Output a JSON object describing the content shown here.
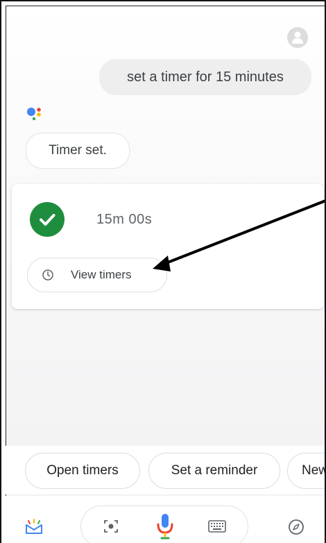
{
  "conversation": {
    "user_query": "set a timer for 15 minutes",
    "assistant_reply": "Timer set."
  },
  "timer_card": {
    "status_icon": "check-circle-icon",
    "remaining": "15m 00s",
    "view_button_label": "View timers",
    "view_button_icon": "clock-icon"
  },
  "suggestions": {
    "chips": [
      "Open timers",
      "Set a reminder",
      "New"
    ]
  },
  "bottom_bar": {
    "icons": [
      "snapshot-icon",
      "lens-icon",
      "mic-icon",
      "keyboard-icon",
      "explore-icon"
    ]
  },
  "colors": {
    "check_green": "#1e8e3e",
    "google_blue": "#4285f4",
    "google_red": "#ea4335",
    "google_yellow": "#fbbc04",
    "google_green": "#34a853"
  }
}
